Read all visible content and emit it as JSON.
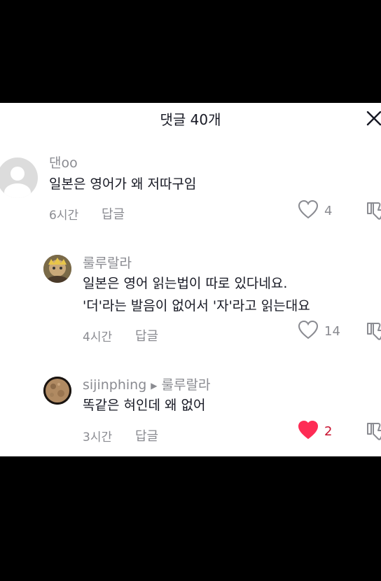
{
  "header": {
    "title": "댓글 40개"
  },
  "comments": [
    {
      "username": "댄oo",
      "lines": [
        "일본은 영어가 왜 저따구임"
      ],
      "time": "6시간",
      "reply_label": "답글",
      "likes": "4",
      "liked": false
    },
    {
      "username": "룰루랄라",
      "lines": [
        "일본은 영어 읽는법이 따로 있다네요.",
        "'더'라는 발음이 없어서 '자'라고 읽는대요"
      ],
      "time": "4시간",
      "reply_label": "답글",
      "likes": "14",
      "liked": false
    },
    {
      "username": "sijinphing",
      "reply_to": "룰루랄라",
      "lines": [
        "똑같은 혀인데 왜 없어"
      ],
      "time": "3시간",
      "reply_label": "답글",
      "likes": "2",
      "liked": true
    }
  ],
  "colors": {
    "like_active": "#fe2c55",
    "muted": "#8a8b91",
    "text": "#161823"
  }
}
